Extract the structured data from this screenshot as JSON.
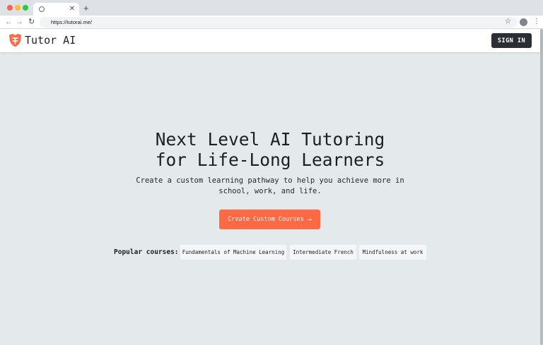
{
  "browser": {
    "url": "https://tutorai.me/",
    "icons": {
      "back": "arrow-left-icon",
      "forward": "arrow-right-icon",
      "reload": "reload-icon",
      "bookmark": "star-icon",
      "profile": "profile-icon",
      "menu": "kebab-menu-icon",
      "new_tab": "plus-icon",
      "close_tab": "close-icon"
    }
  },
  "header": {
    "logo_text": "Tutor AI",
    "sign_in_label": "SIGN IN"
  },
  "hero": {
    "headline_line1": "Next Level AI Tutoring",
    "headline_line2": "for Life-Long Learners",
    "subtitle_line1": "Create a custom learning pathway to help you achieve more in",
    "subtitle_line2": "school, work, and life.",
    "cta_label": "Create Custom Courses",
    "cta_arrow": "→"
  },
  "popular": {
    "label": "Popular courses:",
    "courses": [
      "Fundamentals of Machine Learning",
      "Intermediate French",
      "Mindfulness at work"
    ]
  },
  "colors": {
    "accent": "#fd6943",
    "background": "#e4e9eb",
    "dark_button": "#2b2f35",
    "text": "#1c1f23"
  }
}
